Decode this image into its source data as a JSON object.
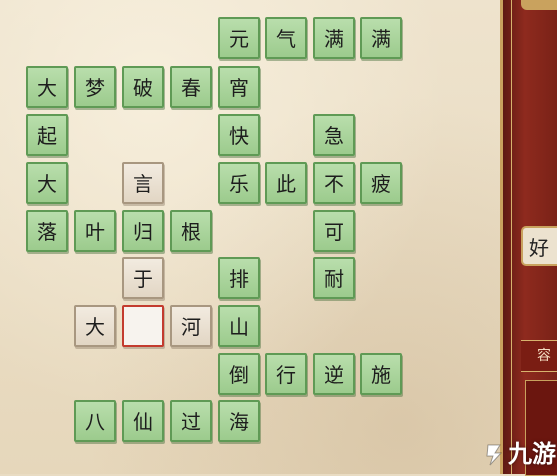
{
  "board": {
    "tiles": [
      {
        "char": "元",
        "style": "green"
      },
      {
        "char": "气",
        "style": "green"
      },
      {
        "char": "满",
        "style": "green"
      },
      {
        "char": "满",
        "style": "green"
      },
      {
        "char": "大",
        "style": "green"
      },
      {
        "char": "梦",
        "style": "green"
      },
      {
        "char": "破",
        "style": "green"
      },
      {
        "char": "春",
        "style": "green"
      },
      {
        "char": "宵",
        "style": "green"
      },
      {
        "char": "起",
        "style": "green"
      },
      {
        "char": "快",
        "style": "green"
      },
      {
        "char": "急",
        "style": "green"
      },
      {
        "char": "大",
        "style": "green"
      },
      {
        "char": "言",
        "style": "clue"
      },
      {
        "char": "乐",
        "style": "green"
      },
      {
        "char": "此",
        "style": "green"
      },
      {
        "char": "不",
        "style": "green"
      },
      {
        "char": "疲",
        "style": "green"
      },
      {
        "char": "落",
        "style": "green"
      },
      {
        "char": "叶",
        "style": "green"
      },
      {
        "char": "归",
        "style": "green"
      },
      {
        "char": "根",
        "style": "green"
      },
      {
        "char": "可",
        "style": "green"
      },
      {
        "char": "于",
        "style": "clue"
      },
      {
        "char": "排",
        "style": "green"
      },
      {
        "char": "耐",
        "style": "green"
      },
      {
        "char": "大",
        "style": "clue"
      },
      {
        "char": "",
        "style": "empty"
      },
      {
        "char": "河",
        "style": "clue"
      },
      {
        "char": "山",
        "style": "green"
      },
      {
        "char": "倒",
        "style": "green"
      },
      {
        "char": "行",
        "style": "green"
      },
      {
        "char": "逆",
        "style": "green"
      },
      {
        "char": "施",
        "style": "green"
      },
      {
        "char": "八",
        "style": "green"
      },
      {
        "char": "仙",
        "style": "green"
      },
      {
        "char": "过",
        "style": "green"
      },
      {
        "char": "海",
        "style": "green"
      }
    ]
  },
  "side_panel": {
    "button_label": "好",
    "caption": "容"
  },
  "watermark": {
    "text": "九游"
  },
  "colors": {
    "tile_green": "#a9d39b",
    "tile_green_border": "#5f9a55",
    "tile_clue": "#ebe3d6",
    "empty_border": "#c33b2e",
    "panel_red": "#8e2a1e",
    "gold": "#c9a25e"
  }
}
